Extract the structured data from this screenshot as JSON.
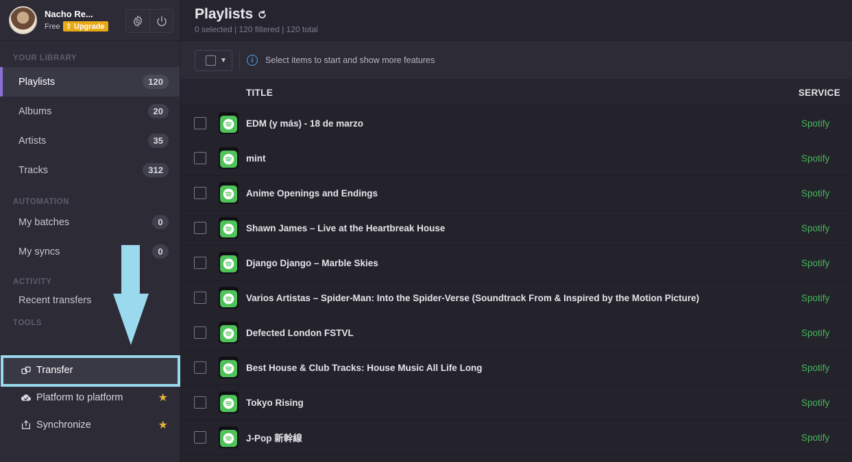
{
  "profile": {
    "name": "Nacho Re...",
    "plan": "Free",
    "upgrade": "Upgrade"
  },
  "sidebar": {
    "library_title": "YOUR LIBRARY",
    "library": [
      {
        "label": "Playlists",
        "count": "120",
        "active": true
      },
      {
        "label": "Albums",
        "count": "20"
      },
      {
        "label": "Artists",
        "count": "35"
      },
      {
        "label": "Tracks",
        "count": "312"
      }
    ],
    "automation_title": "AUTOMATION",
    "automation": [
      {
        "label": "My batches",
        "count": "0"
      },
      {
        "label": "My syncs",
        "count": "0"
      }
    ],
    "activity_title": "ACTIVITY",
    "activity": [
      {
        "label": "Recent transfers"
      }
    ],
    "tools_title": "TOOLS",
    "tools": [
      {
        "label": "Transfer",
        "icon": "transfer-icon"
      },
      {
        "label": "Platform to platform",
        "icon": "platform-icon",
        "star": "★"
      },
      {
        "label": "Synchronize",
        "icon": "sync-icon",
        "star": "★"
      }
    ]
  },
  "header": {
    "title": "Playlists",
    "subtitle": "0 selected | 120 filtered | 120 total"
  },
  "toolbar": {
    "caret": "▼",
    "info_icon": "i",
    "info": "Select items to start and show more features"
  },
  "table": {
    "columns": {
      "title": "TITLE",
      "service": "SERVICE"
    },
    "rows": [
      {
        "title": "EDM (y más) - 18 de marzo",
        "service": "Spotify"
      },
      {
        "title": "mint",
        "service": "Spotify"
      },
      {
        "title": "Anime Openings and Endings",
        "service": "Spotify"
      },
      {
        "title": "Shawn James – Live at the Heartbreak House",
        "service": "Spotify"
      },
      {
        "title": "Django Django – Marble Skies",
        "service": "Spotify"
      },
      {
        "title": "Varios Artistas – Spider-Man: Into the Spider-Verse (Soundtrack From & Inspired by the Motion Picture)",
        "service": "Spotify"
      },
      {
        "title": "Defected London FSTVL",
        "service": "Spotify"
      },
      {
        "title": "Best House & Club Tracks: House Music All Life Long",
        "service": "Spotify"
      },
      {
        "title": "Tokyo Rising",
        "service": "Spotify"
      },
      {
        "title": "J-Pop 新幹線",
        "service": "Spotify"
      }
    ]
  },
  "colors": {
    "accent": "#8b6fd1",
    "spotify_green": "#46b65a",
    "upgrade": "#e8a917",
    "highlight": "#9ad9ee"
  }
}
